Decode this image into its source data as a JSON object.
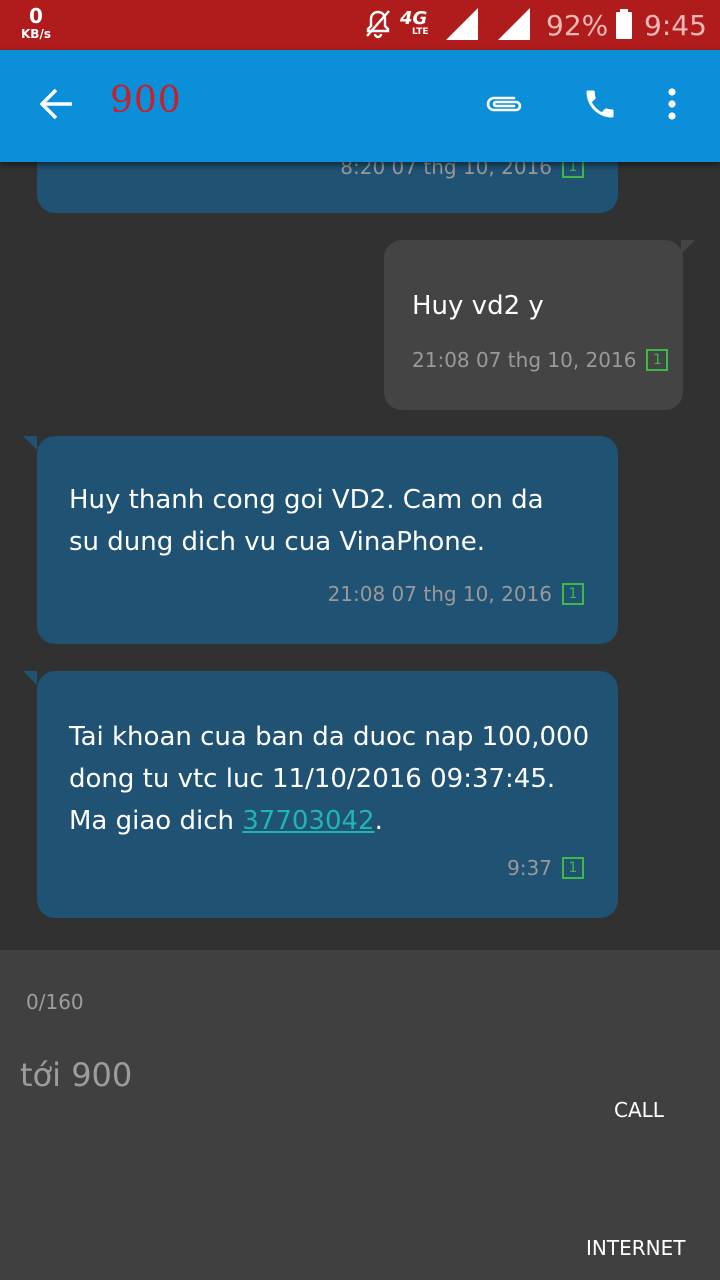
{
  "status_bar": {
    "net_speed": "0",
    "net_speed_unit": "KB/s",
    "network_type": "4G",
    "network_sub": "LTE",
    "battery_percent": "92%",
    "time": "9:45",
    "icons": [
      "notifications-off-icon",
      "signal-4g-icon",
      "signal-icon-sim1",
      "signal-icon-sim2",
      "battery-icon"
    ]
  },
  "app_bar": {
    "contact": "900",
    "icons": [
      "back-arrow-icon",
      "attach-icon",
      "phone-icon",
      "more-vert-icon"
    ],
    "colors": {
      "bar": "#0a8fd8",
      "title": "#c8202a"
    }
  },
  "messages": [
    {
      "direction": "incoming",
      "text": "",
      "timestamp": "8:20 07 thg 10, 2016",
      "sim": "1"
    },
    {
      "direction": "outgoing",
      "text": "Huy vd2 y",
      "timestamp": "21:08 07 thg 10, 2016",
      "sim": "1"
    },
    {
      "direction": "incoming",
      "text_lines": [
        "Huy thanh cong goi VD2. Cam on da",
        "su dung dich vu cua VinaPhone."
      ],
      "timestamp": "21:08 07 thg 10, 2016",
      "sim": "1"
    },
    {
      "direction": "incoming",
      "text_lines": [
        "Tai khoan cua ban da duoc nap 100,000",
        "dong tu vtc luc 11/10/2016 09:37:45.",
        "Ma giao dich "
      ],
      "link": "37703042",
      "text_end": ".",
      "timestamp": "9:37",
      "sim": "1"
    }
  ],
  "compose": {
    "char_count": "0/160",
    "placeholder": "tới 900",
    "send_call_label": "CALL",
    "send_internet_label": "INTERNET"
  }
}
